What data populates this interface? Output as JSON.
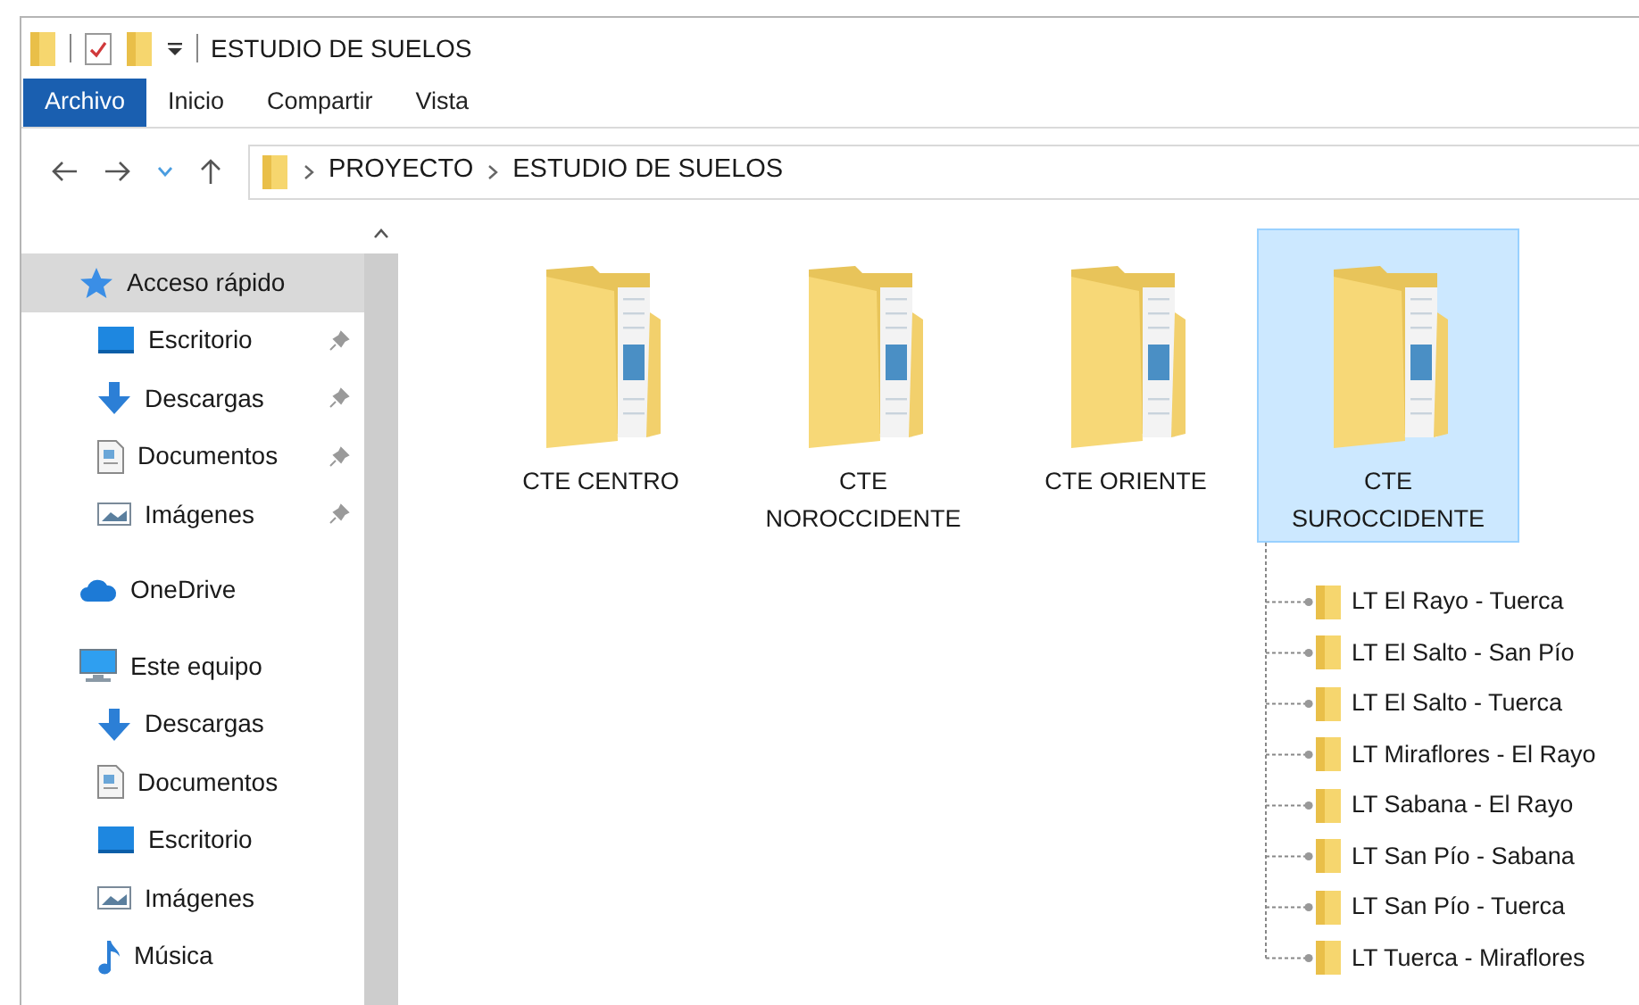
{
  "window": {
    "title": "ESTUDIO DE SUELOS"
  },
  "ribbon_tabs": [
    {
      "label": "Archivo",
      "selected": true
    },
    {
      "label": "Inicio",
      "selected": false
    },
    {
      "label": "Compartir",
      "selected": false
    },
    {
      "label": "Vista",
      "selected": false
    }
  ],
  "address": {
    "path": [
      "PROYECTO",
      "ESTUDIO DE SUELOS"
    ]
  },
  "sidebar": {
    "items": [
      {
        "label": "Acceso rápido",
        "kind": "star",
        "selected": true,
        "children": [
          {
            "label": "Escritorio",
            "kind": "desktop",
            "pinned": true
          },
          {
            "label": "Descargas",
            "kind": "download",
            "pinned": true
          },
          {
            "label": "Documentos",
            "kind": "document",
            "pinned": true
          },
          {
            "label": "Imágenes",
            "kind": "image",
            "pinned": true
          }
        ]
      },
      {
        "label": "OneDrive",
        "kind": "cloud",
        "selected": false
      },
      {
        "label": "Este equipo",
        "kind": "computer",
        "selected": false,
        "children": [
          {
            "label": "Descargas",
            "kind": "download",
            "pinned": false
          },
          {
            "label": "Documentos",
            "kind": "document",
            "pinned": false
          },
          {
            "label": "Escritorio",
            "kind": "desktop",
            "pinned": false
          },
          {
            "label": "Imágenes",
            "kind": "image",
            "pinned": false
          },
          {
            "label": "Música",
            "kind": "music",
            "pinned": false
          }
        ]
      }
    ]
  },
  "folders": [
    {
      "label": "CTE CENTRO",
      "selected": false
    },
    {
      "label": "CTE NOROCCIDENTE",
      "selected": false
    },
    {
      "label": "CTE ORIENTE",
      "selected": false
    },
    {
      "label": "CTE SUROCCIDENTE",
      "selected": true,
      "children": [
        {
          "label": "LT El Rayo - Tuerca"
        },
        {
          "label": "LT El Salto - San Pío"
        },
        {
          "label": "LT El Salto - Tuerca"
        },
        {
          "label": "LT Miraflores - El Rayo"
        },
        {
          "label": "LT Sabana - El Rayo"
        },
        {
          "label": "LT San Pío - Sabana"
        },
        {
          "label": "LT San Pío - Tuerca"
        },
        {
          "label": "LT Tuerca - Miraflores"
        }
      ]
    }
  ]
}
